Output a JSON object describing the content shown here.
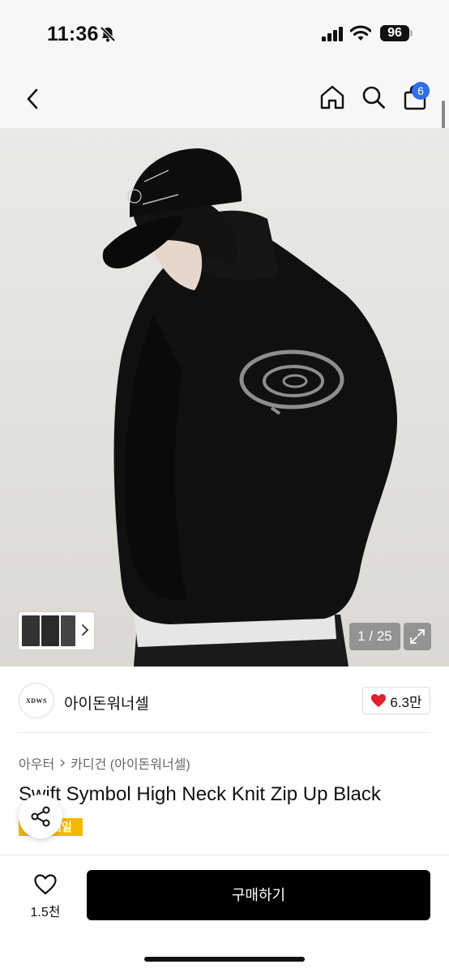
{
  "status": {
    "time": "11:36",
    "battery": "96"
  },
  "nav": {
    "cart_count": "6"
  },
  "gallery": {
    "counter": "1 / 25"
  },
  "brand": {
    "logo_text": "XDWS",
    "name": "아이돈워너셀",
    "likes": "6.3만"
  },
  "breadcrumb": {
    "category": "아우터",
    "subcategory": "카디건 (아이돈워너셀)"
  },
  "product": {
    "title": "Swift Symbol High Neck Knit Zip Up Black",
    "sale_badge": "세일"
  },
  "bottom": {
    "wish_count": "1.5천",
    "buy_label": "구매하기"
  },
  "colors": {
    "accent": "#2f6ee8",
    "sale": "#f5b800",
    "heart": "#e0202c",
    "buy": "#000000"
  }
}
